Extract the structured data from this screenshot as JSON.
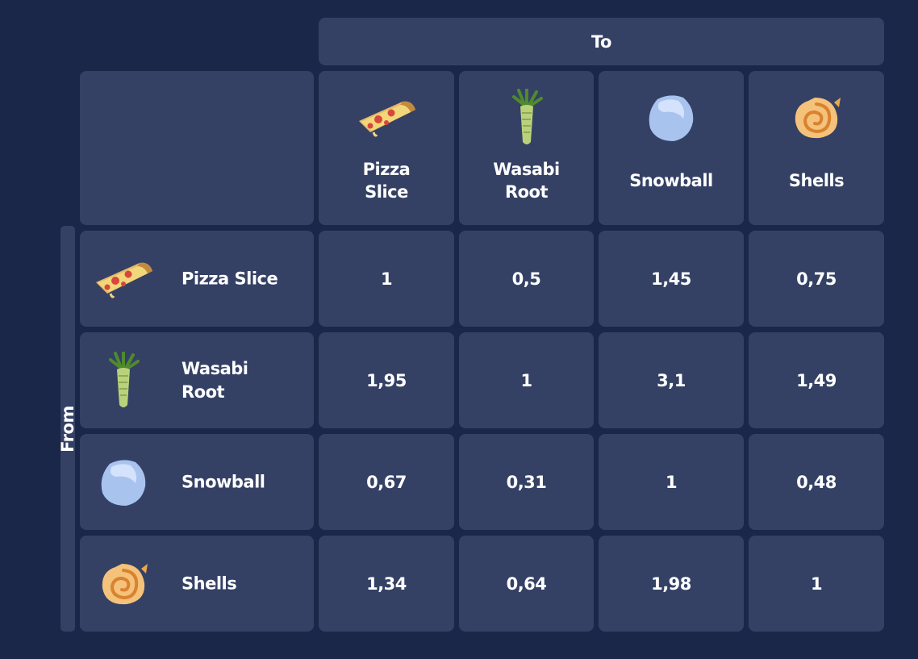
{
  "headers": {
    "to": "To",
    "from": "From"
  },
  "items": [
    {
      "key": "pizza",
      "col_label": [
        "Pizza",
        "Slice"
      ],
      "row_label": [
        "Pizza Slice"
      ],
      "icon": "pizza-slice-icon"
    },
    {
      "key": "wasabi",
      "col_label": [
        "Wasabi",
        "Root"
      ],
      "row_label": [
        "Wasabi",
        "Root"
      ],
      "icon": "wasabi-root-icon"
    },
    {
      "key": "snowball",
      "col_label": [
        "Snowball"
      ],
      "row_label": [
        "Snowball"
      ],
      "icon": "snowball-icon"
    },
    {
      "key": "shells",
      "col_label": [
        "Shells"
      ],
      "row_label": [
        "Shells"
      ],
      "icon": "shell-icon"
    }
  ],
  "matrix": [
    [
      "1",
      "0,5",
      "1,45",
      "0,75"
    ],
    [
      "1,95",
      "1",
      "3,1",
      "1,49"
    ],
    [
      "0,67",
      "0,31",
      "1",
      "0,48"
    ],
    [
      "1,34",
      "0,64",
      "1,98",
      "1"
    ]
  ],
  "colors": {
    "background": "#1a2749",
    "cell": "#344165",
    "text": "#ffffff"
  }
}
